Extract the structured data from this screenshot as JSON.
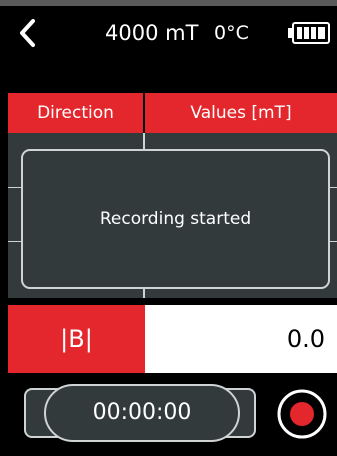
{
  "header": {
    "range": "4000 mT",
    "temperature": "0°C",
    "icons": {
      "back": "chevron-left-icon",
      "battery": "battery-full-icon"
    }
  },
  "table": {
    "columns": [
      "Direction",
      "Values [mT]"
    ],
    "rows": [
      {
        "label": "|B|",
        "value": "0.0"
      }
    ]
  },
  "toast": {
    "message": "Recording started"
  },
  "recorder": {
    "timer": "00:00:00",
    "icon": "record-icon"
  },
  "colors": {
    "accent": "#e4272c",
    "panel": "#323a3c",
    "outline": "#cfd3d4",
    "background": "#000000"
  }
}
